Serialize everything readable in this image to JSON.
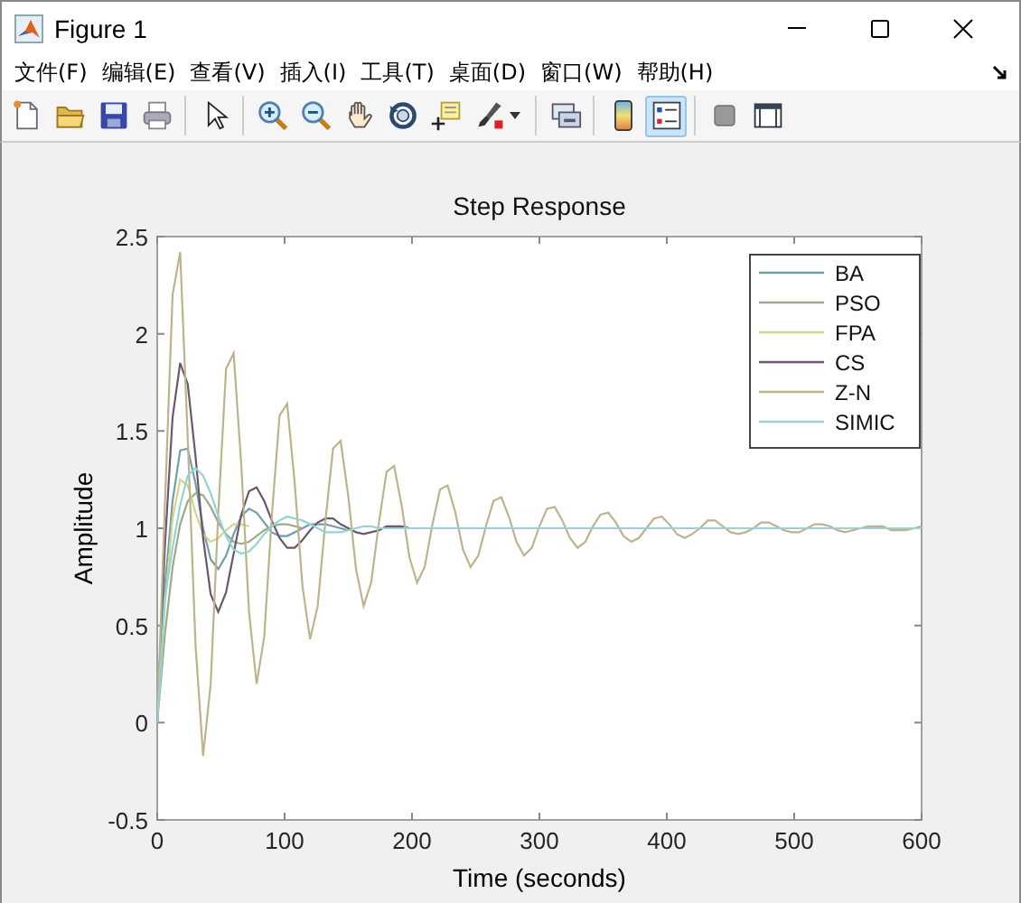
{
  "window": {
    "title": "Figure 1"
  },
  "menu": [
    "文件(F)",
    "编辑(E)",
    "查看(V)",
    "插入(I)",
    "工具(T)",
    "桌面(D)",
    "窗口(W)",
    "帮助(H)"
  ],
  "toolbar": [
    {
      "kind": "new",
      "selected": false
    },
    {
      "kind": "open",
      "selected": false
    },
    {
      "kind": "save",
      "selected": false
    },
    {
      "kind": "print",
      "selected": false
    },
    {
      "kind": "separator"
    },
    {
      "kind": "pointer",
      "selected": false
    },
    {
      "kind": "separator"
    },
    {
      "kind": "zoom-in",
      "selected": false
    },
    {
      "kind": "zoom-out",
      "selected": false
    },
    {
      "kind": "pan",
      "selected": false
    },
    {
      "kind": "rotate",
      "selected": false
    },
    {
      "kind": "data-cursor",
      "selected": false
    },
    {
      "kind": "brush",
      "selected": false
    },
    {
      "kind": "separator"
    },
    {
      "kind": "link",
      "selected": false
    },
    {
      "kind": "separator"
    },
    {
      "kind": "colorbar",
      "selected": false
    },
    {
      "kind": "legend",
      "selected": true
    },
    {
      "kind": "separator"
    },
    {
      "kind": "square",
      "selected": false
    },
    {
      "kind": "layout",
      "selected": false
    }
  ],
  "axes": {
    "chart_data": {
      "type": "line",
      "title": "Step Response",
      "xlabel": "Time (seconds)",
      "ylabel": "Amplitude",
      "x": [
        0,
        6,
        12,
        18,
        24,
        30,
        36,
        42,
        48,
        54,
        60,
        66,
        72,
        78,
        84,
        90,
        96,
        102,
        108,
        114,
        120,
        126,
        132,
        138,
        144,
        150,
        156,
        162,
        168,
        174,
        180,
        186,
        192,
        198,
        204,
        210,
        216,
        222,
        228,
        234,
        240,
        246,
        252,
        258,
        264,
        270,
        276,
        282,
        288,
        294,
        300,
        306,
        312,
        318,
        324,
        330,
        336,
        342,
        348,
        354,
        360,
        366,
        372,
        378,
        384,
        390,
        396,
        402,
        408,
        414,
        420,
        426,
        432,
        438,
        444,
        450,
        456,
        462,
        468,
        474,
        480,
        486,
        492,
        498,
        504,
        510,
        516,
        522,
        528,
        534,
        540,
        546,
        552,
        558,
        564,
        570,
        576,
        582,
        588,
        594,
        600
      ],
      "series": [
        {
          "name": "BA",
          "color": "#6f9fa8",
          "values": [
            0,
            0.69,
            1.14,
            1.4,
            1.41,
            1.23,
            1.0,
            0.84,
            0.79,
            0.86,
            0.97,
            1.06,
            1.1,
            1.08,
            1.03,
            0.98,
            0.96,
            0.96,
            0.98,
            1.0,
            1.02,
            1.02,
            1.02,
            1.01,
            1.0,
            0.99,
            null,
            null,
            null,
            null,
            null,
            null,
            null,
            null,
            null,
            null,
            null,
            null,
            null,
            null,
            null,
            null,
            null,
            null,
            null,
            null,
            null,
            null,
            null,
            null,
            null,
            null,
            null,
            null,
            null,
            null,
            null,
            null,
            null,
            null,
            null,
            null,
            null,
            null,
            null,
            null,
            null,
            null,
            null,
            null,
            null,
            null,
            null,
            null,
            null,
            null,
            null,
            null,
            null,
            null,
            null,
            null,
            null,
            null,
            null,
            null,
            null,
            null,
            null,
            null,
            null,
            null,
            null,
            null,
            null,
            null,
            null,
            null,
            null,
            null,
            null
          ]
        },
        {
          "name": "PSO",
          "color": "#9aaa8c",
          "values": [
            0,
            0.45,
            0.8,
            1.02,
            1.14,
            1.18,
            1.17,
            1.11,
            1.03,
            0.97,
            0.93,
            0.92,
            0.93,
            0.96,
            0.99,
            1.01,
            1.02,
            1.02,
            1.01,
            1.0,
            null,
            null,
            null,
            null,
            null,
            null,
            null,
            null,
            null,
            null,
            null,
            null,
            null,
            null,
            null,
            null,
            null,
            null,
            null,
            null,
            null,
            null,
            null,
            null,
            null,
            null,
            null,
            null,
            null,
            null,
            null,
            null,
            null,
            null,
            null,
            null,
            null,
            null,
            null,
            null,
            null,
            null,
            null,
            null,
            null,
            null,
            null,
            null,
            null,
            null,
            null,
            null,
            null,
            null,
            null,
            null,
            null,
            null,
            null,
            null,
            null,
            null,
            null,
            null,
            null,
            null,
            null,
            null,
            null,
            null,
            null,
            null,
            null,
            null,
            null,
            null,
            null,
            null,
            null,
            null,
            null
          ]
        },
        {
          "name": "FPA",
          "color": "#d6d48a",
          "values": [
            0,
            0.6,
            1.05,
            1.25,
            1.22,
            1.08,
            0.97,
            0.93,
            0.95,
            0.99,
            1.02,
            1.02,
            1.01,
            null,
            null,
            null,
            null,
            null,
            null,
            null,
            null,
            null,
            null,
            null,
            null,
            null,
            null,
            null,
            null,
            null,
            null,
            null,
            null,
            null,
            null,
            null,
            null,
            null,
            null,
            null,
            null,
            null,
            null,
            null,
            null,
            null,
            null,
            null,
            null,
            null,
            null,
            null,
            null,
            null,
            null,
            null,
            null,
            null,
            null,
            null,
            null,
            null,
            null,
            null,
            null,
            null,
            null,
            null,
            null,
            null,
            null,
            null,
            null,
            null,
            null,
            null,
            null,
            null,
            null,
            null,
            null,
            null,
            null,
            null,
            null,
            null,
            null,
            null,
            null,
            null,
            null,
            null,
            null,
            null,
            null,
            null,
            null,
            null,
            null,
            null,
            null
          ]
        },
        {
          "name": "CS",
          "color": "#6e566e",
          "values": [
            0,
            0.9,
            1.57,
            1.85,
            1.74,
            1.37,
            0.95,
            0.66,
            0.57,
            0.67,
            0.87,
            1.07,
            1.19,
            1.21,
            1.14,
            1.04,
            0.95,
            0.9,
            0.9,
            0.94,
            0.99,
            1.03,
            1.05,
            1.05,
            1.02,
            1.0,
            0.98,
            0.97,
            0.98,
            0.99,
            1.01,
            1.01,
            1.01,
            1.0,
            null,
            null,
            null,
            null,
            null,
            null,
            null,
            null,
            null,
            null,
            null,
            null,
            null,
            null,
            null,
            null,
            null,
            null,
            null,
            null,
            null,
            null,
            null,
            null,
            null,
            null,
            null,
            null,
            null,
            null,
            null,
            null,
            null,
            null,
            null,
            null,
            null,
            null,
            null,
            null,
            null,
            null,
            null,
            null,
            null,
            null,
            null,
            null,
            null,
            null,
            null,
            null,
            null,
            null,
            null,
            null,
            null,
            null,
            null,
            null,
            null,
            null,
            null,
            null,
            null,
            null,
            null
          ]
        },
        {
          "name": "Z-N",
          "color": "#bdb38c",
          "values": [
            0,
            1.11,
            2.2,
            2.42,
            1.46,
            0.4,
            -0.17,
            0.2,
            1.08,
            1.82,
            1.9,
            1.33,
            0.57,
            0.2,
            0.44,
            1.06,
            1.58,
            1.64,
            1.23,
            0.7,
            0.43,
            0.6,
            1.04,
            1.41,
            1.45,
            1.16,
            0.79,
            0.6,
            0.72,
            1.03,
            1.29,
            1.32,
            1.11,
            0.85,
            0.72,
            0.8,
            1.02,
            1.2,
            1.22,
            1.08,
            0.89,
            0.8,
            0.86,
            1.01,
            1.14,
            1.16,
            1.06,
            0.93,
            0.86,
            0.9,
            1.01,
            1.1,
            1.11,
            1.04,
            0.95,
            0.9,
            0.93,
            1.01,
            1.07,
            1.08,
            1.03,
            0.96,
            0.93,
            0.95,
            1.0,
            1.05,
            1.06,
            1.02,
            0.97,
            0.95,
            0.97,
            1.0,
            1.04,
            1.04,
            1.01,
            0.98,
            0.97,
            0.98,
            1.0,
            1.03,
            1.03,
            1.01,
            0.99,
            0.98,
            0.98,
            1.0,
            1.02,
            1.02,
            1.01,
            0.99,
            0.98,
            0.99,
            1.0,
            1.01,
            1.01,
            1.01,
            0.99,
            0.99,
            0.99,
            1.0,
            1.01
          ]
        },
        {
          "name": "SIMIC",
          "color": "#94d4d4",
          "values": [
            0,
            0.64,
            0.9,
            1.12,
            1.27,
            1.31,
            1.27,
            1.18,
            1.06,
            0.96,
            0.89,
            0.87,
            0.88,
            0.92,
            0.97,
            1.01,
            1.04,
            1.06,
            1.05,
            1.04,
            1.02,
            1.0,
            0.98,
            0.98,
            0.98,
            0.99,
            1.0,
            1.01,
            1.01,
            1,
            1,
            1,
            1,
            1,
            1,
            1,
            1,
            1,
            1,
            1,
            1,
            1,
            1,
            1,
            1,
            1,
            1,
            1,
            1,
            1,
            1,
            1,
            1,
            1,
            1,
            1,
            1,
            1,
            1,
            1,
            1,
            1,
            1,
            1,
            1,
            1,
            1,
            1,
            1,
            1,
            1,
            1,
            1,
            1,
            1,
            1,
            1,
            1,
            1,
            1,
            1,
            1,
            1,
            1,
            1,
            1,
            1,
            1,
            1,
            1,
            1,
            1,
            1,
            1,
            1,
            1,
            1,
            1,
            1,
            1,
            1
          ]
        }
      ],
      "xlim": [
        0,
        600
      ],
      "ylim": [
        -0.5,
        2.5
      ],
      "xticks": [
        0,
        100,
        200,
        300,
        400,
        500,
        600
      ],
      "yticks": [
        -0.5,
        0,
        0.5,
        1,
        1.5,
        2,
        2.5
      ],
      "legend": true
    }
  }
}
